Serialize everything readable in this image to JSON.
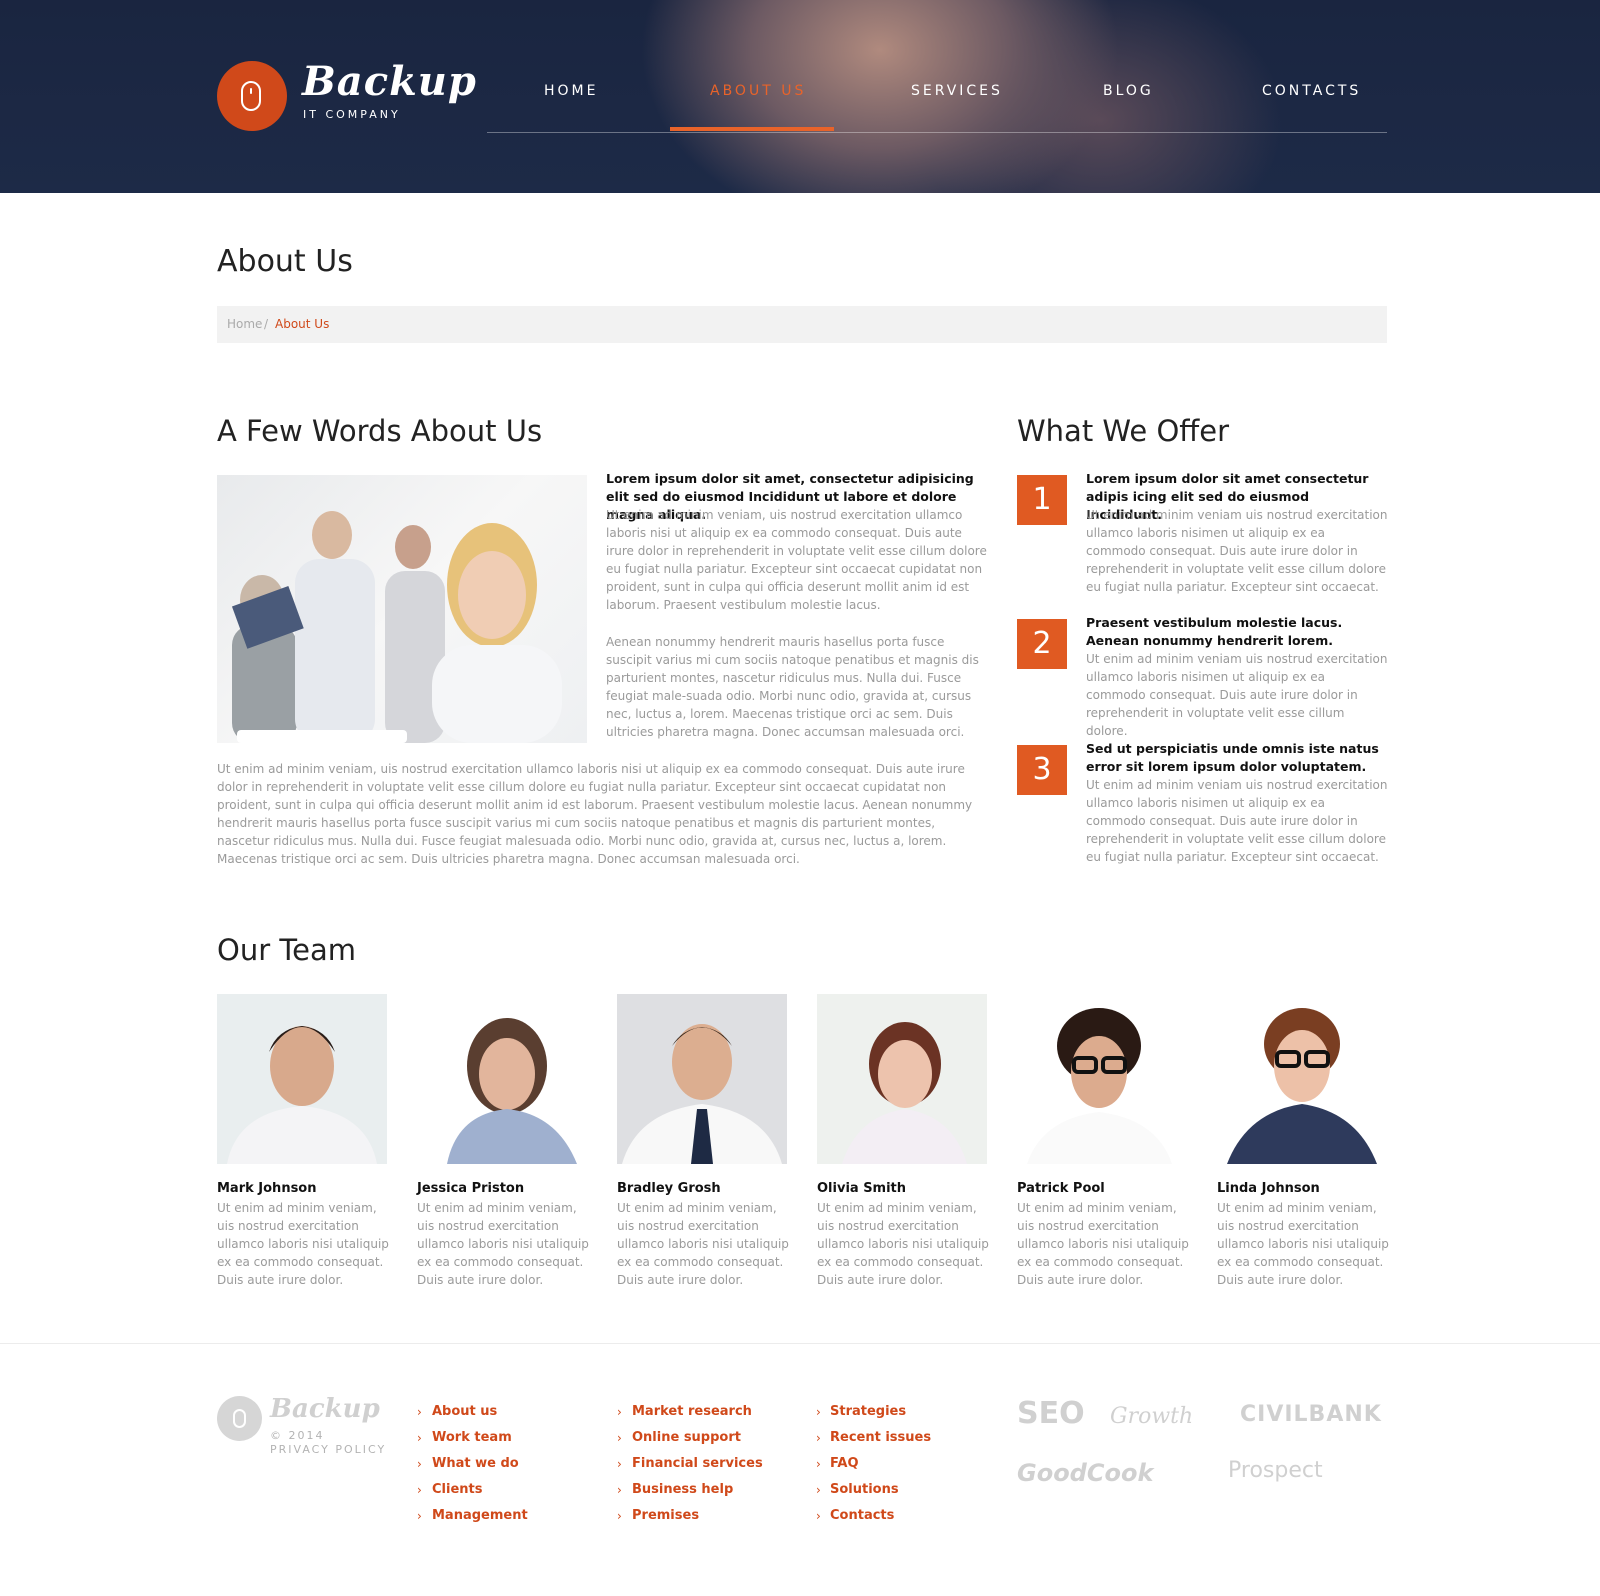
{
  "brand": {
    "name": "Backup",
    "tagline": "IT COMPANY",
    "accent": "#e8632a"
  },
  "nav": {
    "items": [
      {
        "label": "HOME",
        "active": false
      },
      {
        "label": "ABOUT US",
        "active": true
      },
      {
        "label": "SERVICES",
        "active": false
      },
      {
        "label": "BLOG",
        "active": false
      },
      {
        "label": "CONTACTS",
        "active": false
      }
    ]
  },
  "page": {
    "title": "About Us",
    "breadcrumb": {
      "home": "Home",
      "separator": "/",
      "current": "About Us"
    }
  },
  "about": {
    "heading": "A Few Words About Us",
    "lead": "Lorem ipsum dolor sit amet, consectetur adipisicing elit sed do eiusmod Incididunt ut labore et dolore magna aliqua.",
    "para1": "Ut enim ad minim veniam, uis nostrud exercitation ullamco laboris nisi ut aliquip ex ea commodo consequat. Duis aute irure dolor in reprehenderit in voluptate velit esse cillum dolore eu fugiat nulla pariatur. Excepteur sint occaecat cupidatat non proident, sunt in culpa qui officia deserunt mollit anim id est laborum. Praesent vestibulum molestie lacus.",
    "para2": "Aenean nonummy hendrerit mauris hasellus porta fusce suscipit varius mi cum sociis natoque penatibus et magnis dis parturient montes, nascetur ridiculus mus. Nulla dui. Fusce feugiat male-suada odio. Morbi nunc odio, gravida at, cursus nec, luctus a, lorem. Maecenas tristique orci ac sem. Duis ultricies pharetra magna. Donec accumsan malesuada orci.",
    "para3": "Ut enim ad minim veniam, uis nostrud exercitation ullamco laboris nisi ut aliquip ex ea commodo consequat. Duis aute irure dolor in reprehenderit in voluptate velit esse cillum dolore eu fugiat nulla pariatur. Excepteur sint occaecat cupidatat non proident, sunt in culpa qui officia deserunt mollit anim id est laborum. Praesent vestibulum molestie lacus. Aenean nonummy hendrerit mauris hasellus porta fusce suscipit varius mi cum sociis natoque penatibus et magnis dis parturient montes, nascetur ridiculus mus. Nulla dui. Fusce feugiat malesuada odio. Morbi nunc odio, gravida at, cursus nec, luctus a, lorem. Maecenas tristique orci ac sem. Duis ultricies pharetra magna. Donec accumsan malesuada orci."
  },
  "offer": {
    "heading": "What We Offer",
    "items": [
      {
        "num": "1",
        "title": "Lorem ipsum dolor sit amet consectetur adipis icing elit sed do eiusmod Incididunt.",
        "text": "Ut enim ad minim veniam uis nostrud exercitation ullamco laboris nisimen ut aliquip ex ea commodo consequat. Duis aute irure dolor in reprehenderit in voluptate velit esse cillum dolore eu fugiat nulla pariatur. Excepteur sint occaecat."
      },
      {
        "num": "2",
        "title": "Praesent vestibulum molestie lacus. Aenean nonummy hendrerit lorem.",
        "text": "Ut enim ad minim veniam uis nostrud exercitation ullamco laboris nisimen ut aliquip ex ea commodo consequat. Duis aute irure dolor in reprehenderit in voluptate velit esse cillum dolore."
      },
      {
        "num": "3",
        "title": "Sed ut perspiciatis unde omnis iste natus error sit lorem ipsum dolor voluptatem.",
        "text": "Ut enim ad minim veniam uis nostrud exercitation ullamco laboris nisimen ut aliquip ex ea commodo consequat. Duis aute irure dolor in reprehenderit in voluptate velit esse cillum dolore eu fugiat nulla pariatur. Excepteur sint occaecat."
      }
    ]
  },
  "team": {
    "heading": "Our Team",
    "members": [
      {
        "name": "Mark Johnson",
        "text": "Ut enim ad minim veniam, uis nostrud exercitation ullamco laboris nisi utaliquip ex ea commodo consequat. Duis aute irure dolor."
      },
      {
        "name": "Jessica Priston",
        "text": "Ut enim ad minim veniam, uis nostrud exercitation ullamco laboris nisi utaliquip ex ea commodo consequat. Duis aute irure dolor."
      },
      {
        "name": "Bradley Grosh",
        "text": "Ut enim ad minim veniam, uis nostrud exercitation ullamco laboris nisi utaliquip ex ea commodo consequat. Duis aute irure dolor."
      },
      {
        "name": "Olivia Smith",
        "text": "Ut enim ad minim veniam, uis nostrud exercitation ullamco laboris nisi utaliquip ex ea commodo consequat. Duis aute irure dolor."
      },
      {
        "name": "Patrick Pool",
        "text": "Ut enim ad minim veniam, uis nostrud exercitation ullamco laboris nisi utaliquip ex ea commodo consequat. Duis aute irure dolor."
      },
      {
        "name": "Linda Johnson",
        "text": "Ut enim ad minim veniam, uis nostrud exercitation ullamco laboris nisi utaliquip ex ea commodo consequat. Duis aute irure dolor."
      }
    ]
  },
  "footer": {
    "brand": "Backup",
    "copyright": "© 2014",
    "privacy": "PRIVACY POLICY",
    "col1": [
      "About us",
      "Work team",
      "What we do",
      "Clients",
      "Management"
    ],
    "col2": [
      "Market research",
      "Online support",
      "Financial services",
      "Business help",
      "Premises"
    ],
    "col3": [
      "Strategies",
      "Recent issues",
      "FAQ",
      "Solutions",
      "Contacts"
    ],
    "partners": [
      "SEO",
      "Growth",
      "CIVILBANK",
      "GoodCook",
      "Prospect"
    ]
  }
}
